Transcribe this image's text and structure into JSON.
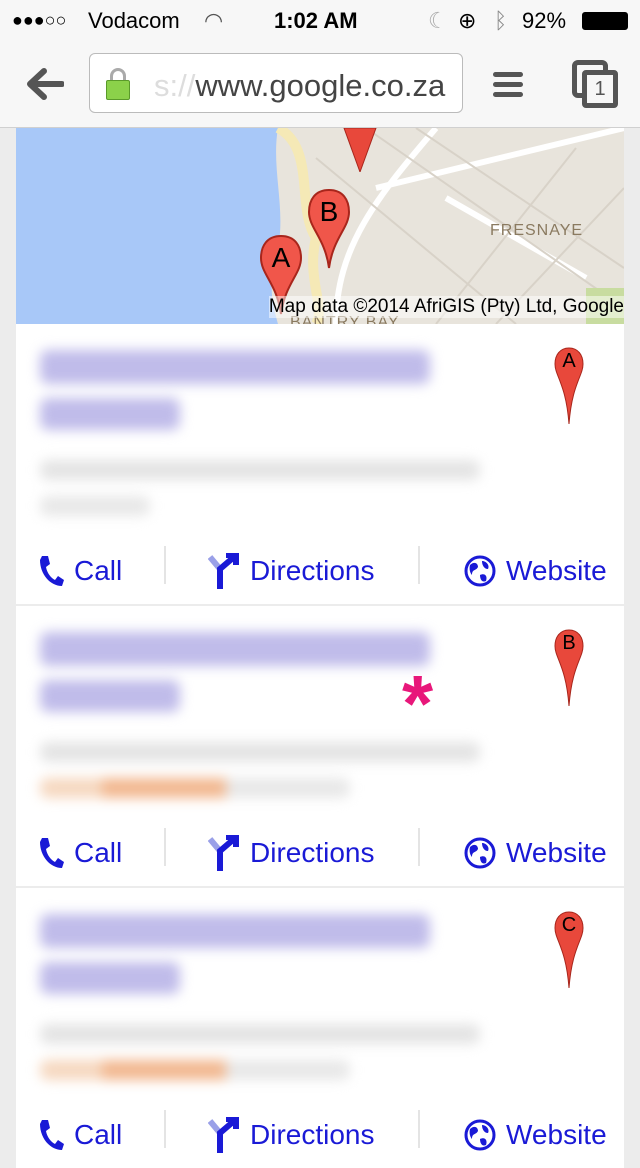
{
  "status_bar": {
    "carrier": "Vodacom",
    "signal": "3 of 5",
    "time": "1:02 AM",
    "battery": "92%"
  },
  "browser": {
    "url_prefix": "s://",
    "url": "www.google.co.za",
    "tabs_count": "1"
  },
  "map": {
    "attribution": "Map data ©2014 AfriGIS (Pty) Ltd, Google",
    "labels": [
      "FRESNAYE",
      "BANTRY BAY"
    ],
    "markers": [
      "A",
      "B"
    ]
  },
  "results": [
    {
      "marker": "A",
      "actions": {
        "call": "Call",
        "directions": "Directions",
        "website": "Website"
      }
    },
    {
      "marker": "B",
      "actions": {
        "call": "Call",
        "directions": "Directions",
        "website": "Website"
      }
    },
    {
      "marker": "C",
      "actions": {
        "call": "Call",
        "directions": "Directions",
        "website": "Website"
      }
    }
  ],
  "colors": {
    "link": "#1a1ad6",
    "marker": "#e8483b",
    "annotation": "#e8177a"
  }
}
